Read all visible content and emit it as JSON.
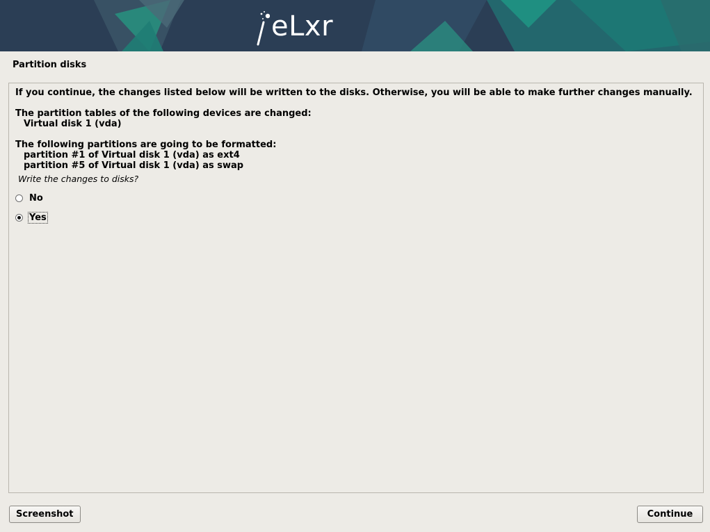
{
  "banner": {
    "logo_text": "eLxr",
    "logo_icon": "test-tube-sparkle-icon",
    "colors": {
      "base": "#2b3e55",
      "teal": "#1f8a7e"
    }
  },
  "page": {
    "title": "Partition disks"
  },
  "content": {
    "intro": "If you continue, the changes listed below will be written to the disks. Otherwise, you will be able to make further changes manually.",
    "tables_heading": "The partition tables of the following devices are changed:",
    "tables_devices": [
      "Virtual disk 1 (vda)"
    ],
    "format_heading": "The following partitions are going to be formatted:",
    "format_partitions": [
      "partition #1 of Virtual disk 1 (vda) as ext4",
      "partition #5 of Virtual disk 1 (vda) as swap"
    ],
    "question": "Write the changes to disks?",
    "options": [
      {
        "label": "No",
        "selected": false
      },
      {
        "label": "Yes",
        "selected": true
      }
    ]
  },
  "buttons": {
    "screenshot": "Screenshot",
    "continue": "Continue"
  }
}
